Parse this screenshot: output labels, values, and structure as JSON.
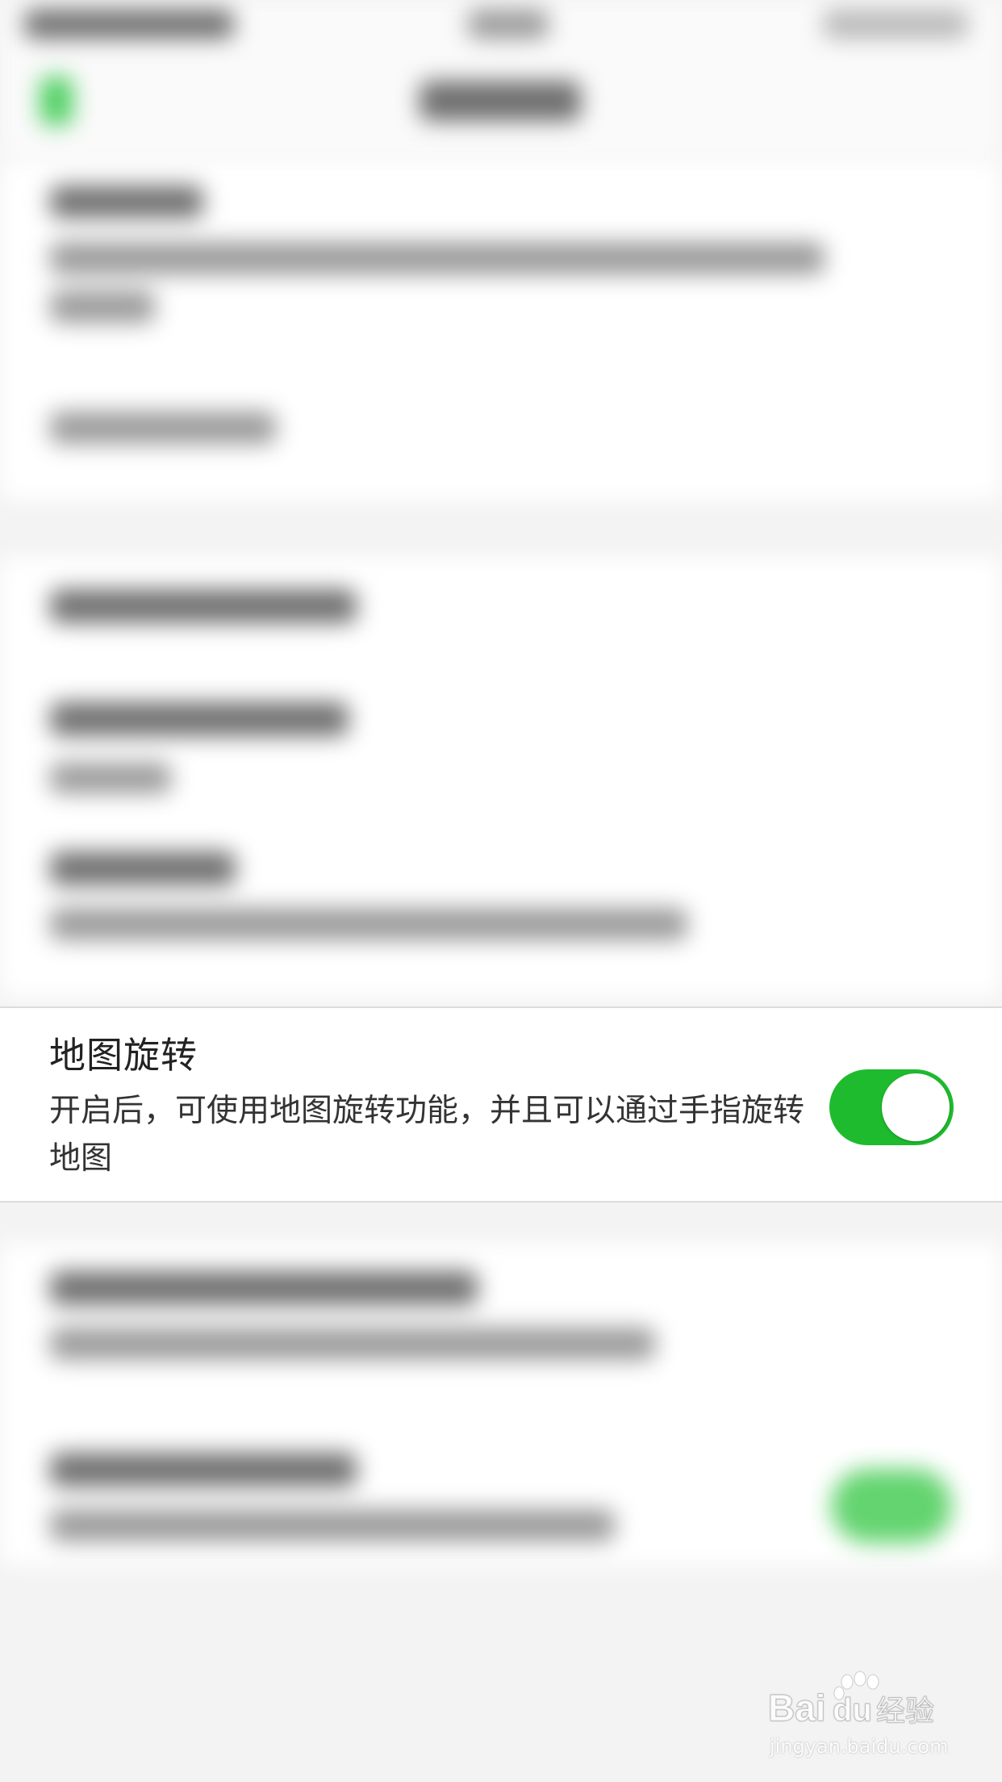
{
  "setting": {
    "title": "地图旋转",
    "description": "开启后，可使用地图旋转功能，并且可以通过手指旋转地图",
    "enabled": true
  },
  "watermark": {
    "brand": "Baidu经验",
    "url": "jingyan.baidu.com"
  },
  "colors": {
    "accent": "#1fbb2e",
    "background": "#f3f3f3"
  }
}
